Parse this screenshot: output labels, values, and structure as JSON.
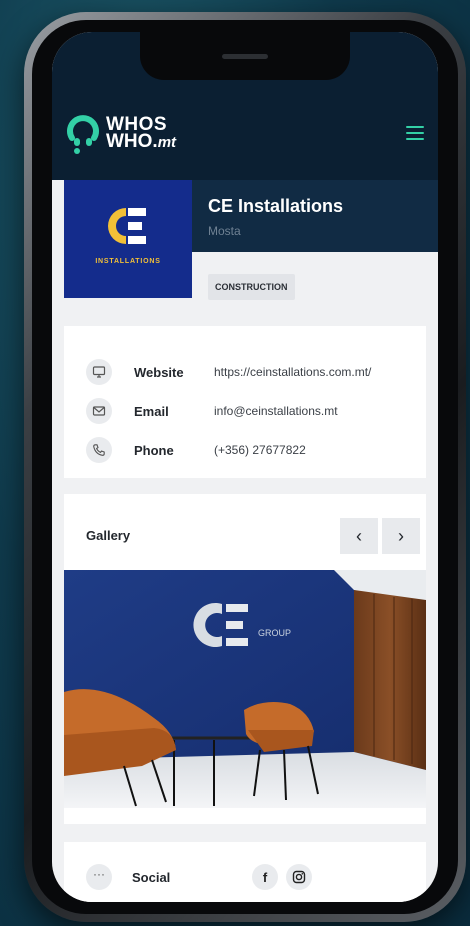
{
  "app": {
    "brand_line1": "WHOS",
    "brand_line2": "WHO.",
    "brand_suffix": "mt",
    "accent_color": "#33d0a6"
  },
  "company": {
    "name": "CE Installations",
    "location": "Mosta",
    "logo_caption": "INSTALLATIONS",
    "category_tag": "CONSTRUCTION"
  },
  "contact": {
    "items": [
      {
        "icon": "monitor-icon",
        "label": "Website",
        "value": "https://ceinstallations.com.mt/"
      },
      {
        "icon": "mail-icon",
        "label": "Email",
        "value": "info@ceinstallations.mt"
      },
      {
        "icon": "phone-icon",
        "label": "Phone",
        "value": "(+356) 27677822"
      }
    ]
  },
  "gallery": {
    "title": "Gallery",
    "prev_label": "‹",
    "next_label": "›",
    "image_sign_text": "GROUP"
  },
  "social": {
    "more_label": "···",
    "label": "Social",
    "facebook_label": "f",
    "networks": [
      "facebook-icon",
      "instagram-icon"
    ]
  }
}
